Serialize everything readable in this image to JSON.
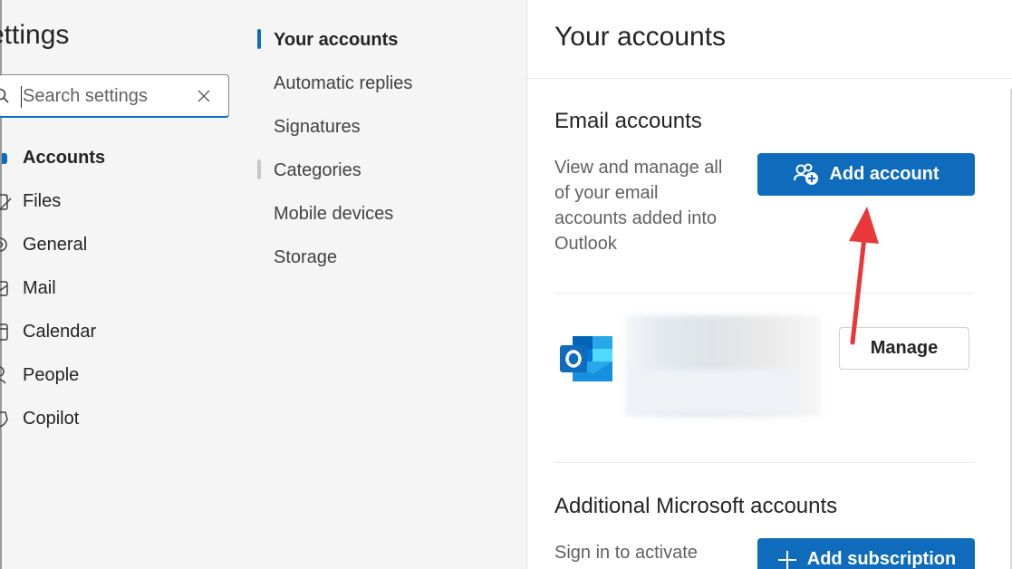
{
  "sidebar": {
    "title": "ettings",
    "search": {
      "placeholder": "Search settings",
      "value": ""
    },
    "items": [
      {
        "label": "Accounts",
        "icon": "person-icon",
        "active": true
      },
      {
        "label": "Files",
        "icon": "paperclip-icon"
      },
      {
        "label": "General",
        "icon": "gear-icon"
      },
      {
        "label": "Mail",
        "icon": "mail-icon"
      },
      {
        "label": "Calendar",
        "icon": "calendar-icon"
      },
      {
        "label": "People",
        "icon": "people-icon"
      },
      {
        "label": "Copilot",
        "icon": "copilot-icon"
      }
    ]
  },
  "subnav": {
    "items": [
      {
        "label": "Your accounts",
        "active": true
      },
      {
        "label": "Automatic replies"
      },
      {
        "label": "Signatures"
      },
      {
        "label": "Categories"
      },
      {
        "label": "Mobile devices"
      },
      {
        "label": "Storage"
      }
    ]
  },
  "main": {
    "title": "Your accounts",
    "email_accounts": {
      "heading": "Email accounts",
      "description": "View and manage all of your email accounts added into Outlook",
      "add_button": "Add account",
      "manage_button": "Manage"
    },
    "additional": {
      "heading": "Additional Microsoft accounts",
      "description": "Sign in to activate",
      "add_subscription_button": "Add subscription"
    }
  },
  "colors": {
    "accent": "#0f6cbd",
    "annotation": "#e8383a"
  }
}
